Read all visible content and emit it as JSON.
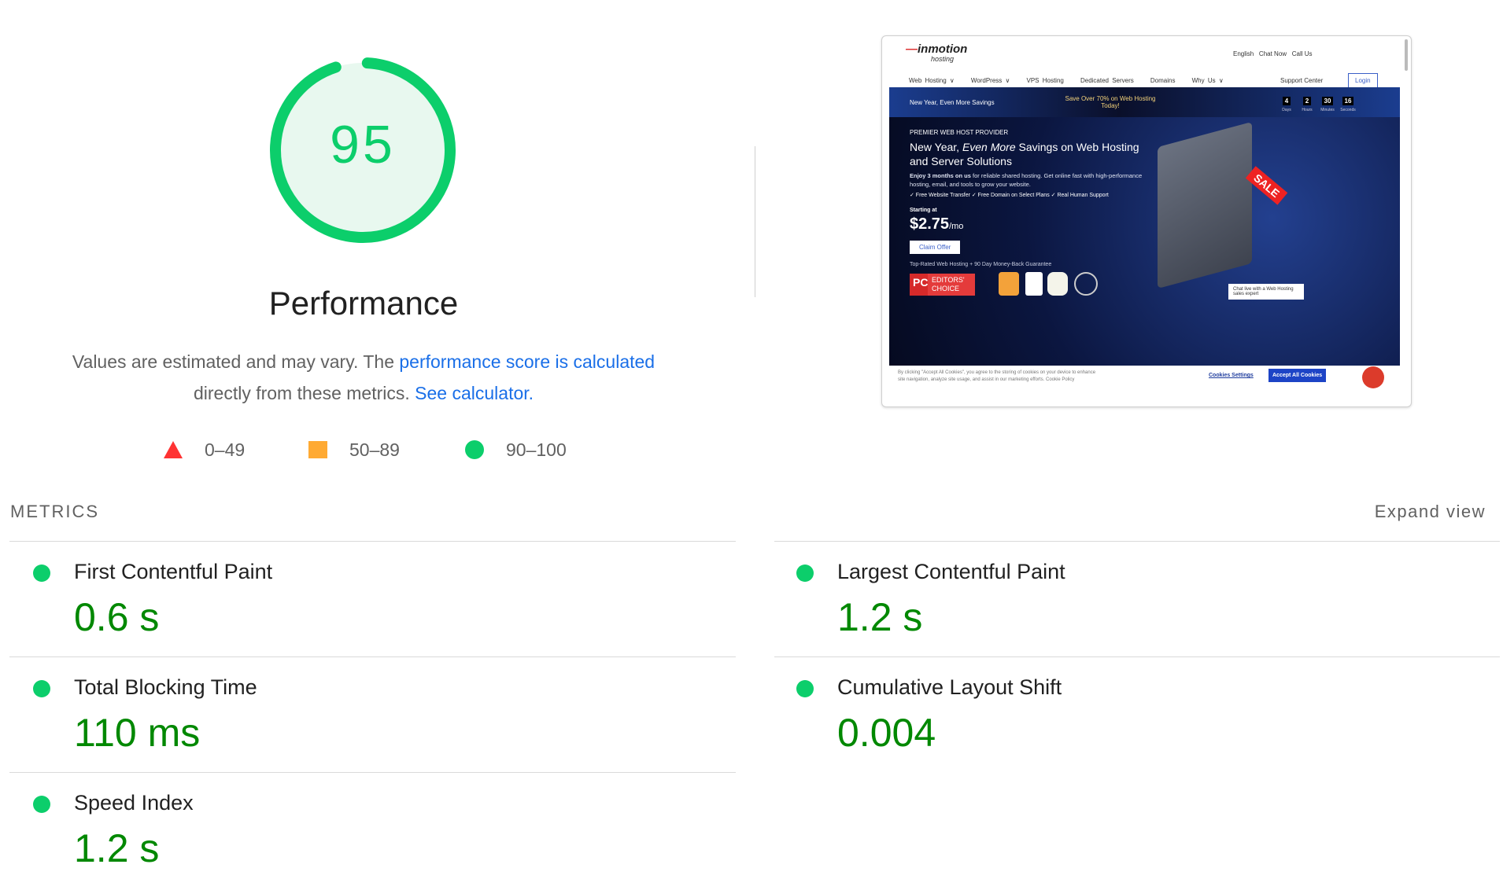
{
  "score": {
    "value": "95",
    "fraction": 0.95,
    "color": "#0cce6b"
  },
  "category_title": "Performance",
  "description": {
    "text1": "Values are estimated and may vary. The ",
    "link1": "performance score is calculated",
    "text2": " directly from these metrics. ",
    "link2": "See calculator."
  },
  "legend": [
    {
      "label": "0–49",
      "icon": "triangle-icon",
      "color": "#ff3333"
    },
    {
      "label": "50–89",
      "icon": "square-icon",
      "color": "#ffaa33"
    },
    {
      "label": "90–100",
      "icon": "circle-icon",
      "color": "#0cce6b"
    }
  ],
  "metrics_header": "METRICS",
  "expand_view": "Expand view",
  "metrics": [
    {
      "title": "First Contentful Paint",
      "value": "0.6 s"
    },
    {
      "title": "Largest Contentful Paint",
      "value": "1.2 s"
    },
    {
      "title": "Total Blocking Time",
      "value": "110 ms"
    },
    {
      "title": "Cumulative Layout Shift",
      "value": "0.004"
    },
    {
      "title": "Speed Index",
      "value": "1.2 s"
    }
  ],
  "thumbnail": {
    "logo": "inmotion",
    "logo_sub": "hosting",
    "top_links": [
      "English",
      "Chat Now",
      "Call Us"
    ],
    "nav": [
      "Web Hosting ∨",
      "WordPress ∨",
      "VPS Hosting",
      "Dedicated Servers",
      "Domains",
      "Why Us ∨"
    ],
    "support": "Support Center",
    "login": "Login",
    "banner_left": "New Year, Even More Savings",
    "banner_mid": "Save Over 70% on Web Hosting Today!",
    "countdown": [
      {
        "n": "4",
        "l": "Days"
      },
      {
        "n": "2",
        "l": "Hours"
      },
      {
        "n": "30",
        "l": "Minutes"
      },
      {
        "n": "16",
        "l": "Seconds"
      }
    ],
    "eyebrow": "PREMIER WEB HOST PROVIDER",
    "headline1": "New Year, ",
    "headline_em": "Even More",
    "headline2": " Savings on Web Hosting and Server Solutions",
    "sub_bold": "Enjoy 3 months on us",
    "sub": " for reliable shared hosting. Get online fast with high-performance hosting, email, and tools to grow your website.",
    "checks": "✓ Free Website Transfer   ✓ Free Domain on Select Plans   ✓ Real Human Support",
    "starting": "Starting at",
    "price": "$2.75",
    "per": "/mo",
    "cta": "Claim Offer",
    "guarantee": "Top-Rated Web Hosting + 90 Day Money-Back Guarantee",
    "badge_pc": "PC",
    "badge_ec": "EDITORS' CHOICE",
    "sale": "SALE",
    "chat": "Chat live with a Web Hosting sales expert",
    "cookie_text": "By clicking \"Accept All Cookies\", you agree to the storing of cookies on your device to enhance site navigation, analyze site usage, and assist in our marketing efforts. Cookie Policy",
    "cookie_settings": "Cookies Settings",
    "cookie_accept": "Accept All Cookies"
  }
}
